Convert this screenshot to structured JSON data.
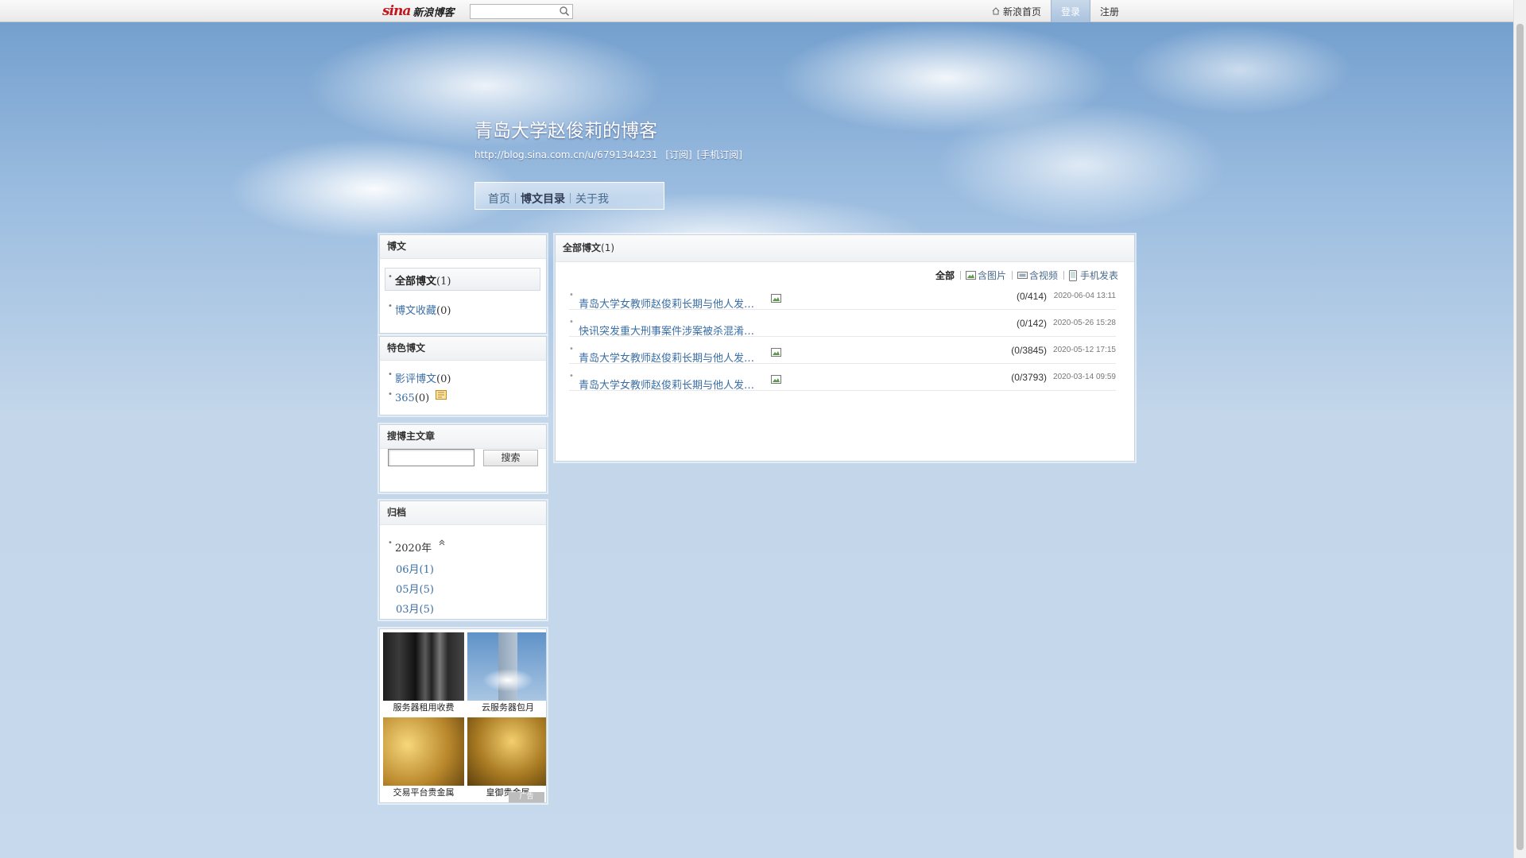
{
  "topbar": {
    "logo_brand": "sina",
    "logo_text": "新浪博客",
    "search_placeholder": "",
    "links": {
      "home": "新浪首页",
      "login": "登录",
      "register": "注册"
    }
  },
  "header": {
    "title": "青岛大学赵俊莉的博客",
    "url": "http://blog.sina.com.cn/u/6791344231",
    "subscribe": "[订阅]",
    "mobile_subscribe": "[手机订阅]"
  },
  "nav": {
    "items": [
      "首页",
      "博文目录",
      "关于我"
    ],
    "active_index": 1
  },
  "sidebar": {
    "posts_panel": {
      "title": "博文",
      "items": [
        {
          "label": "全部博文",
          "count": "(1)",
          "selected": true
        },
        {
          "label": "博文收藏",
          "count": "(0)",
          "selected": false
        }
      ]
    },
    "featured_panel": {
      "title": "特色博文",
      "items": [
        {
          "label": "影评博文",
          "count": "(0)"
        },
        {
          "label": "365",
          "count": "(0)"
        }
      ]
    },
    "search_panel": {
      "title": "搜博主文章",
      "button": "搜索",
      "input_value": ""
    },
    "archive_panel": {
      "title": "归档",
      "year": "2020年",
      "months": [
        "06月(1)",
        "05月(5)",
        "03月(5)"
      ]
    },
    "ad": {
      "tiles": [
        "服务器租用收费",
        "云服务器包月",
        "交易平台贵金属",
        "皇御贵金属"
      ],
      "badge": "广告"
    }
  },
  "content": {
    "header_label": "全部博文",
    "header_count": "(1)",
    "filters": {
      "all": "全部",
      "with_pictures": "含图片",
      "with_video": "含视频",
      "mobile": "手机发表"
    },
    "articles": [
      {
        "title": "青岛大学女教师赵俊莉长期与他人发…",
        "has_picture": true,
        "stats": "(0/414)",
        "date": "2020-06-04 13:11"
      },
      {
        "title": "快讯突发重大刑事案件涉案被杀混淆…",
        "has_picture": false,
        "stats": "(0/142)",
        "date": "2020-05-26 15:28"
      },
      {
        "title": "青岛大学女教师赵俊莉长期与他人发…",
        "has_picture": true,
        "stats": "(0/3845)",
        "date": "2020-05-12 17:15"
      },
      {
        "title": "青岛大学女教师赵俊莉长期与他人发…",
        "has_picture": true,
        "stats": "(0/3793)",
        "date": "2020-03-14 09:59"
      }
    ]
  },
  "colors": {
    "link_blue": "#3a6ea5",
    "logo_red": "#c4161c",
    "login_bg": "#a9c2dd"
  }
}
